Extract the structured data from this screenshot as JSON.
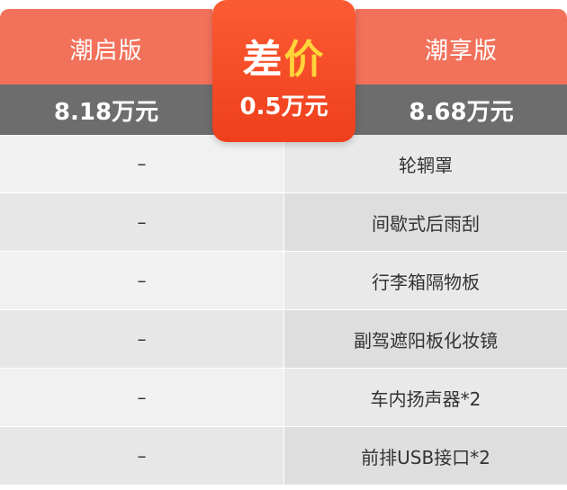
{
  "header": {
    "left_version": "潮启版",
    "right_version": "潮享版",
    "left_price": "8.18万元",
    "right_price": "8.68万元"
  },
  "difference": {
    "title_first": "差",
    "title_last": "价",
    "value": "0.5万元"
  },
  "rows": [
    {
      "left": "–",
      "right": "轮辋罩"
    },
    {
      "left": "–",
      "right": "间歇式后雨刮"
    },
    {
      "left": "–",
      "right": "行李箱隔物板"
    },
    {
      "left": "–",
      "right": "副驾遮阳板化妆镜"
    },
    {
      "left": "–",
      "right": "车内扬声器*2"
    },
    {
      "left": "–",
      "right": "前排USB接口*2"
    }
  ],
  "colors": {
    "header_coral": "#f2715a",
    "price_bar_grey": "#6d6d6d",
    "badge_red": "#ef3f1d",
    "badge_accent_yellow": "#ffd53a"
  }
}
